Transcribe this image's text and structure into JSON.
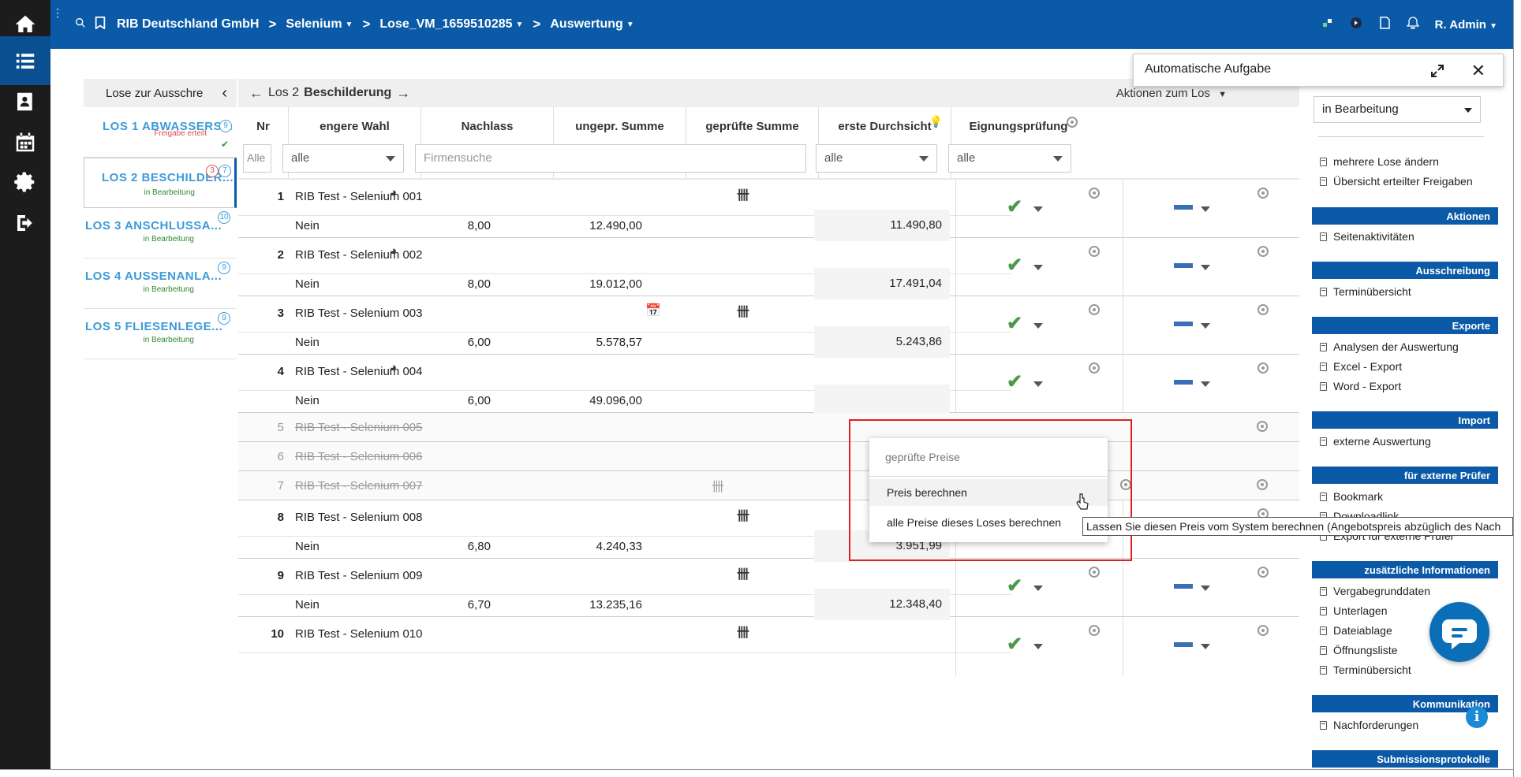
{
  "topbar": {
    "breadcrumb": [
      {
        "label": "RIB Deutschland GmbH",
        "dropdown": false
      },
      {
        "label": "Selenium",
        "dropdown": true
      },
      {
        "label": "Lose_VM_1659510285",
        "dropdown": true
      },
      {
        "label": "Auswertung",
        "dropdown": true
      }
    ],
    "user": "R. Admin"
  },
  "sidebar_icons": [
    "home-icon",
    "list-icon",
    "contacts-icon",
    "calendar-icon",
    "settings-icon",
    "logout-icon"
  ],
  "lots_panel": {
    "title": "Lose zur Ausschre",
    "lots": [
      {
        "name": "LOS 1 ABWASSERS...",
        "status": "Freigabe erteilt",
        "count": "9",
        "extra": ""
      },
      {
        "name": "LOS 2 BESCHILDER...",
        "status": "in Bearbeitung",
        "count": "7",
        "extra": "3"
      },
      {
        "name": "LOS 3 ANSCHLUSSA...",
        "status": "in Bearbeitung",
        "count": "10",
        "extra": ""
      },
      {
        "name": "LOS 4 AUSSENANLA...",
        "status": "in Bearbeitung",
        "count": "9",
        "extra": ""
      },
      {
        "name": "LOS 5 FLIESENLEGE...",
        "status": "in Bearbeitung",
        "count": "9",
        "extra": ""
      }
    ]
  },
  "main": {
    "lot_prefix": "Los 2",
    "lot_name": "Beschilderung",
    "actions_label": "Aktionen zum Los",
    "columns": {
      "nr": "Nr",
      "engere_wahl": "engere Wahl",
      "nachlass": "Nachlass",
      "ungepr": "ungepr. Summe",
      "gepr": "geprüfte Summe",
      "erste_durchsicht": "erste Durchsicht",
      "eignung": "Eignungsprüfung"
    },
    "filters": {
      "nr": "Alle",
      "engere_wahl": "alle",
      "firmensuche_placeholder": "Firmensuche",
      "erste_durchsicht": "alle",
      "eignung": "alle"
    },
    "rows": [
      {
        "nr": "1",
        "name": "RIB Test - Selenium 001",
        "engere": "Nein",
        "nachlass": "8,00",
        "ungepr": "12.490,00",
        "gepr": "11.490,80",
        "excluded": false
      },
      {
        "nr": "2",
        "name": "RIB Test - Selenium 002",
        "engere": "Nein",
        "nachlass": "8,00",
        "ungepr": "19.012,00",
        "gepr": "17.491,04",
        "excluded": false
      },
      {
        "nr": "3",
        "name": "RIB Test - Selenium 003",
        "engere": "Nein",
        "nachlass": "6,00",
        "ungepr": "5.578,57",
        "gepr": "5.243,86",
        "excluded": false
      },
      {
        "nr": "4",
        "name": "RIB Test - Selenium 004",
        "engere": "Nein",
        "nachlass": "6,00",
        "ungepr": "49.096,00",
        "gepr": "",
        "excluded": false
      },
      {
        "nr": "5",
        "name": "RIB Test - Selenium 005",
        "excluded": true
      },
      {
        "nr": "6",
        "name": "RIB Test - Selenium 006",
        "excluded": true
      },
      {
        "nr": "7",
        "name": "RIB Test - Selenium 007",
        "excluded": true
      },
      {
        "nr": "8",
        "name": "RIB Test - Selenium 008",
        "engere": "Nein",
        "nachlass": "6,80",
        "ungepr": "4.240,33",
        "gepr": "3.951,99",
        "excluded": false
      },
      {
        "nr": "9",
        "name": "RIB Test - Selenium 009",
        "engere": "Nein",
        "nachlass": "6,70",
        "ungepr": "13.235,16",
        "gepr": "12.348,40",
        "excluded": false
      },
      {
        "nr": "10",
        "name": "RIB Test - Selenium 010",
        "excluded": false
      }
    ]
  },
  "right_panel": {
    "status_select": "in Bearbeitung",
    "top_items": [
      "mehrere Lose ändern",
      "Übersicht erteilter Freigaben"
    ],
    "sections": [
      {
        "title": "Aktionen",
        "items": [
          "Seitenaktivitäten"
        ]
      },
      {
        "title": "Ausschreibung",
        "items": [
          "Terminübersicht"
        ]
      },
      {
        "title": "Exporte",
        "items": [
          "Analysen der Auswertung",
          "Excel - Export",
          "Word - Export"
        ]
      },
      {
        "title": "Import",
        "items": [
          "externe Auswertung"
        ]
      },
      {
        "title": "für externe Prüfer",
        "items": [
          "Bookmark",
          "Downloadlink",
          "Export für externe Prüfer"
        ]
      },
      {
        "title": "zusätzliche Informationen",
        "items": [
          "Vergabegrunddaten",
          "Unterlagen",
          "Dateiablage",
          "Öffnungsliste",
          "Terminübersicht"
        ]
      },
      {
        "title": "Kommunikation",
        "items": [
          "Nachforderungen"
        ]
      },
      {
        "title": "Submissionsprotokolle",
        "items": []
      }
    ]
  },
  "auto_task": {
    "title": "Automatische Aufgabe"
  },
  "context_menu": {
    "header": "geprüfte Preise",
    "items": [
      "Preis berechnen",
      "alle Preise dieses Loses berechnen"
    ]
  },
  "tooltip": "Lassen Sie diesen Preis vom System berechnen (Angebotspreis abzüglich des Nach"
}
